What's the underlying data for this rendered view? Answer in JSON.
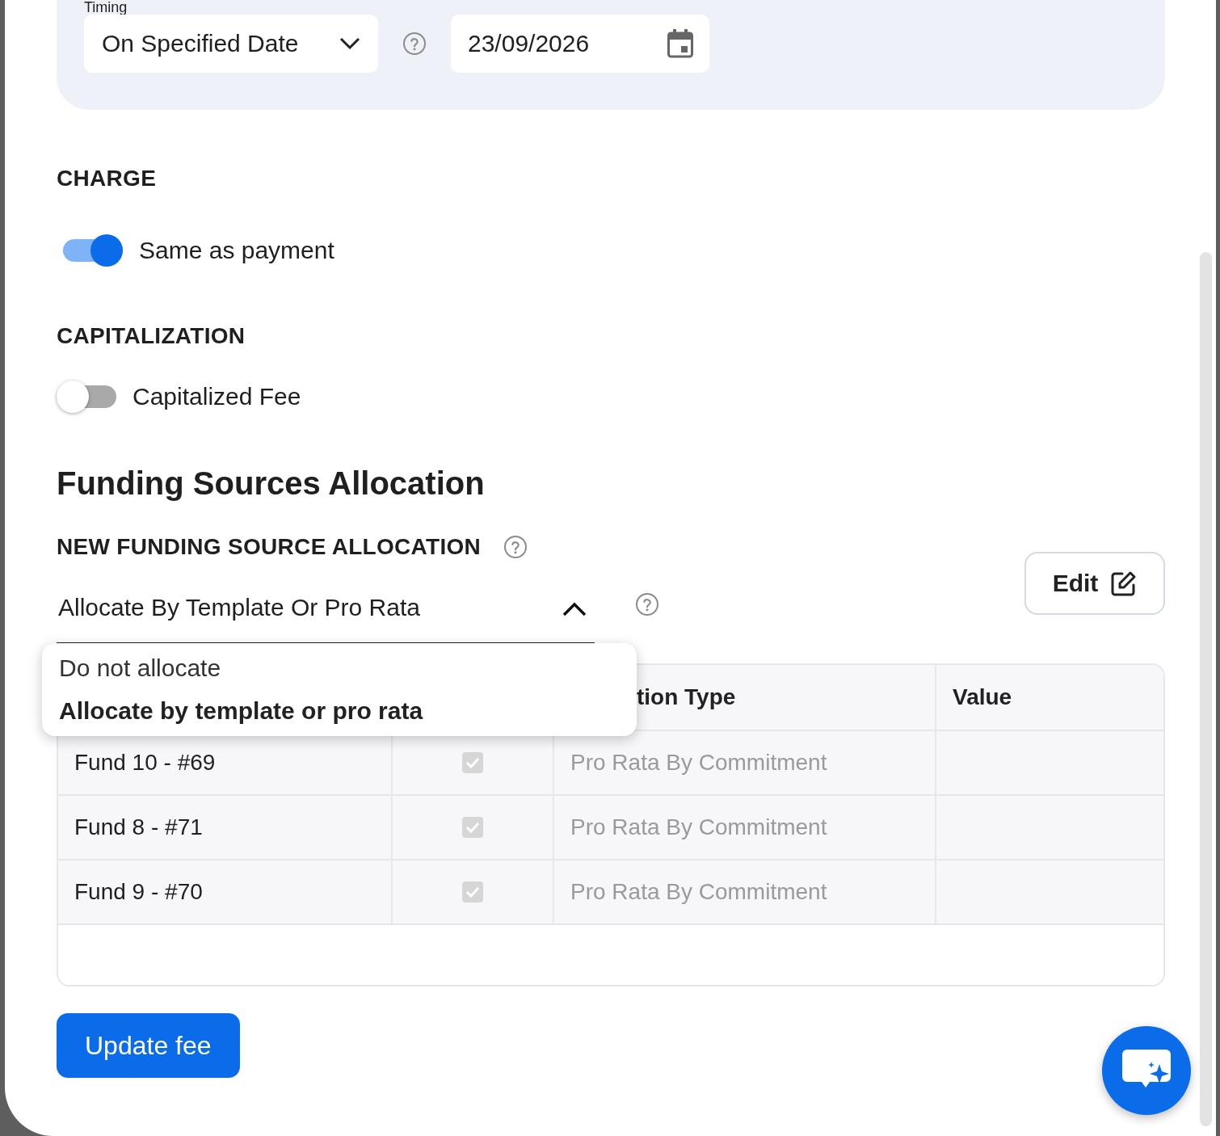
{
  "timing": {
    "label": "Timing",
    "select": {
      "value": "On Specified Date"
    },
    "date": {
      "value": "23/09/2026"
    }
  },
  "charge": {
    "heading": "CHARGE",
    "toggle": {
      "label": "Same as payment",
      "on": true
    }
  },
  "capitalization": {
    "heading": "CAPITALIZATION",
    "toggle": {
      "label": "Capitalized Fee",
      "on": false
    }
  },
  "funding": {
    "title": "Funding Sources Allocation",
    "subheading": "NEW FUNDING SOURCE ALLOCATION",
    "select": {
      "value": "Allocate By Template Or Pro Rata",
      "expanded": true
    },
    "menu": [
      {
        "label": "Do not allocate",
        "selected": false
      },
      {
        "label": "Allocate by template or pro rata",
        "selected": true
      }
    ],
    "edit_button": "Edit",
    "table": {
      "column_3": "tion Type",
      "column_4": "Value",
      "rows": [
        {
          "fund": "Fund 10 - #69",
          "checked": true,
          "disabled": true,
          "type": "Pro Rata By Commitment"
        },
        {
          "fund": "Fund 8 - #71",
          "checked": true,
          "disabled": true,
          "type": "Pro Rata By Commitment"
        },
        {
          "fund": "Fund 9 - #70",
          "checked": true,
          "disabled": true,
          "type": "Pro Rata By Commitment"
        }
      ]
    }
  },
  "update_button": "Update fee"
}
